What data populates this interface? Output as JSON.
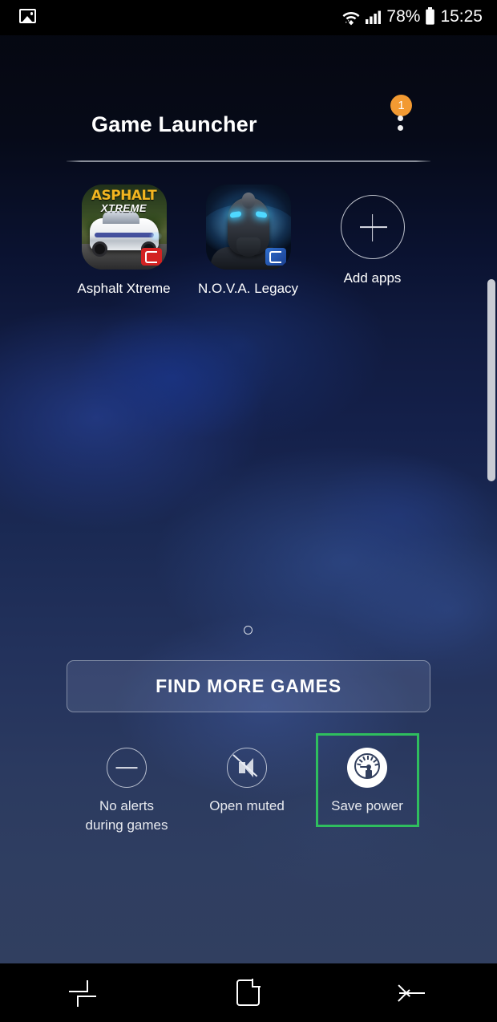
{
  "statusbar": {
    "left_icon": "image-icon",
    "wifi_icon": "wifi-icon",
    "signal_icon": "cellular-signal-icon",
    "battery_percent": "78%",
    "battery_icon": "battery-icon",
    "time": "15:25"
  },
  "header": {
    "title": "Game Launcher",
    "overflow_badge": "1",
    "overflow_icon": "more-options-icon"
  },
  "apps": [
    {
      "name": "Asphalt Xtreme",
      "icon": "asphalt-xtreme-icon",
      "title_top": "ASPHALT",
      "title_bottom": "XTREME"
    },
    {
      "name": "N.O.V.A. Legacy",
      "icon": "nova-legacy-icon"
    },
    {
      "name": "Add apps",
      "icon": "plus-circle-icon"
    }
  ],
  "page_indicator": {
    "current": 1,
    "total": 1
  },
  "find_more": {
    "label": "FIND MORE GAMES"
  },
  "options": [
    {
      "label_line1": "No alerts",
      "label_line2": "during games",
      "icon": "minus-circle-icon",
      "selected": false
    },
    {
      "label_line1": "Open muted",
      "label_line2": "",
      "icon": "mute-circle-icon",
      "selected": false
    },
    {
      "label_line1": "Save power",
      "label_line2": "",
      "icon": "save-power-gauge-icon",
      "selected": true
    }
  ],
  "highlight": {
    "color": "#2fbe5e",
    "target": "Save power"
  },
  "navbar": {
    "recents": "recents-icon",
    "home": "home-icon",
    "back": "back-icon"
  }
}
